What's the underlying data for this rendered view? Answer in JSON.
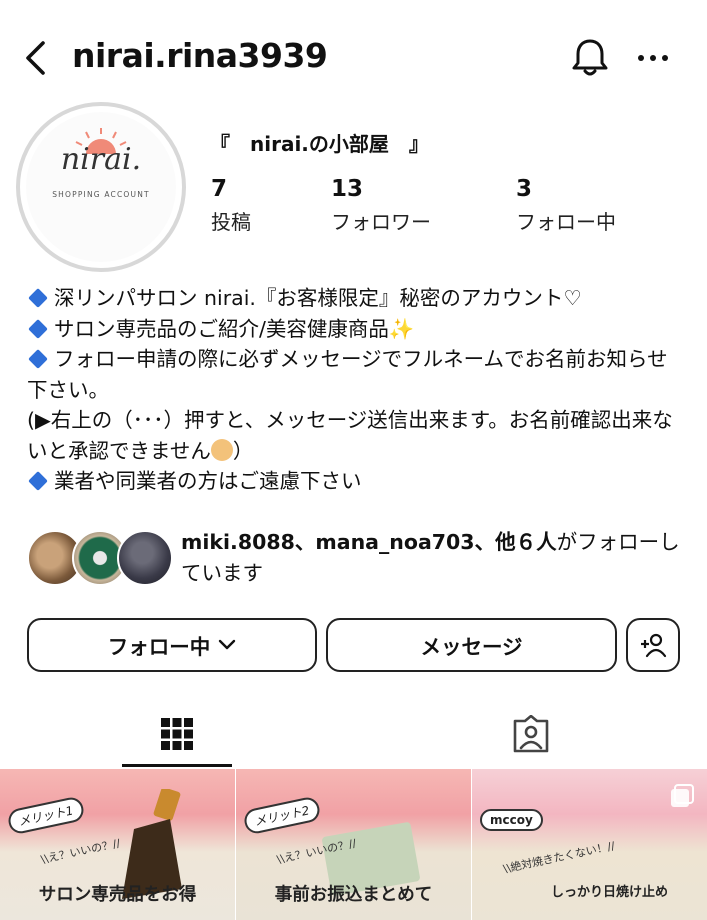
{
  "header": {
    "username": "nirai.rina3939",
    "back_icon": "chevron-left-icon",
    "bell_icon": "bell-icon",
    "more_icon": "more-horizontal-icon"
  },
  "avatar": {
    "logo_text": "nirai.",
    "sub_text": "SHOPPING ACCOUNT"
  },
  "profile": {
    "display_name": "『　nirai.の小部屋　』",
    "stats": [
      {
        "value": "7",
        "label": "投稿"
      },
      {
        "value": "13",
        "label": "フォロワー"
      },
      {
        "value": "3",
        "label": "フォロー中"
      }
    ]
  },
  "bio": {
    "line1": "深リンパサロン nirai.『お客様限定』秘密のアカウント♡",
    "line2": "サロン専売品のご紹介/美容健康商品",
    "line2_emoji": "✨",
    "line3": "フォロー申請の際に必ずメッセージでフルネームでお名前お知らせ下さい。",
    "line4": "(▶︎右上の（･･･）押すと、メッセージ送信出来ます。お名前確認出来ないと承認できません",
    "line4_end": "）",
    "line5": "業者や同業者の方はご遠慮下さい"
  },
  "followed_by": {
    "users": "miki.8088、mana_noa703、他６人",
    "suffix": "がフォローしています"
  },
  "actions": {
    "following_label": "フォロー中",
    "message_label": "メッセージ",
    "add_user_icon": "add-user-icon"
  },
  "tabs": {
    "grid_icon": "grid-icon",
    "tagged_icon": "tagged-user-icon"
  },
  "posts": [
    {
      "tag": "メリット1",
      "small": "\\\\え？いいの？//",
      "big": "サロン専売品をお得"
    },
    {
      "tag": "メリット2",
      "small": "\\\\え？いいの？//",
      "big": "事前お振込まとめて"
    },
    {
      "tag": "mccoy",
      "small": "\\\\絶対焼きたくない！//",
      "big": "しっかり日焼け止め"
    }
  ],
  "colors": {
    "diamond": "#2f6fd8",
    "post_pink": "#f3a5a8"
  }
}
